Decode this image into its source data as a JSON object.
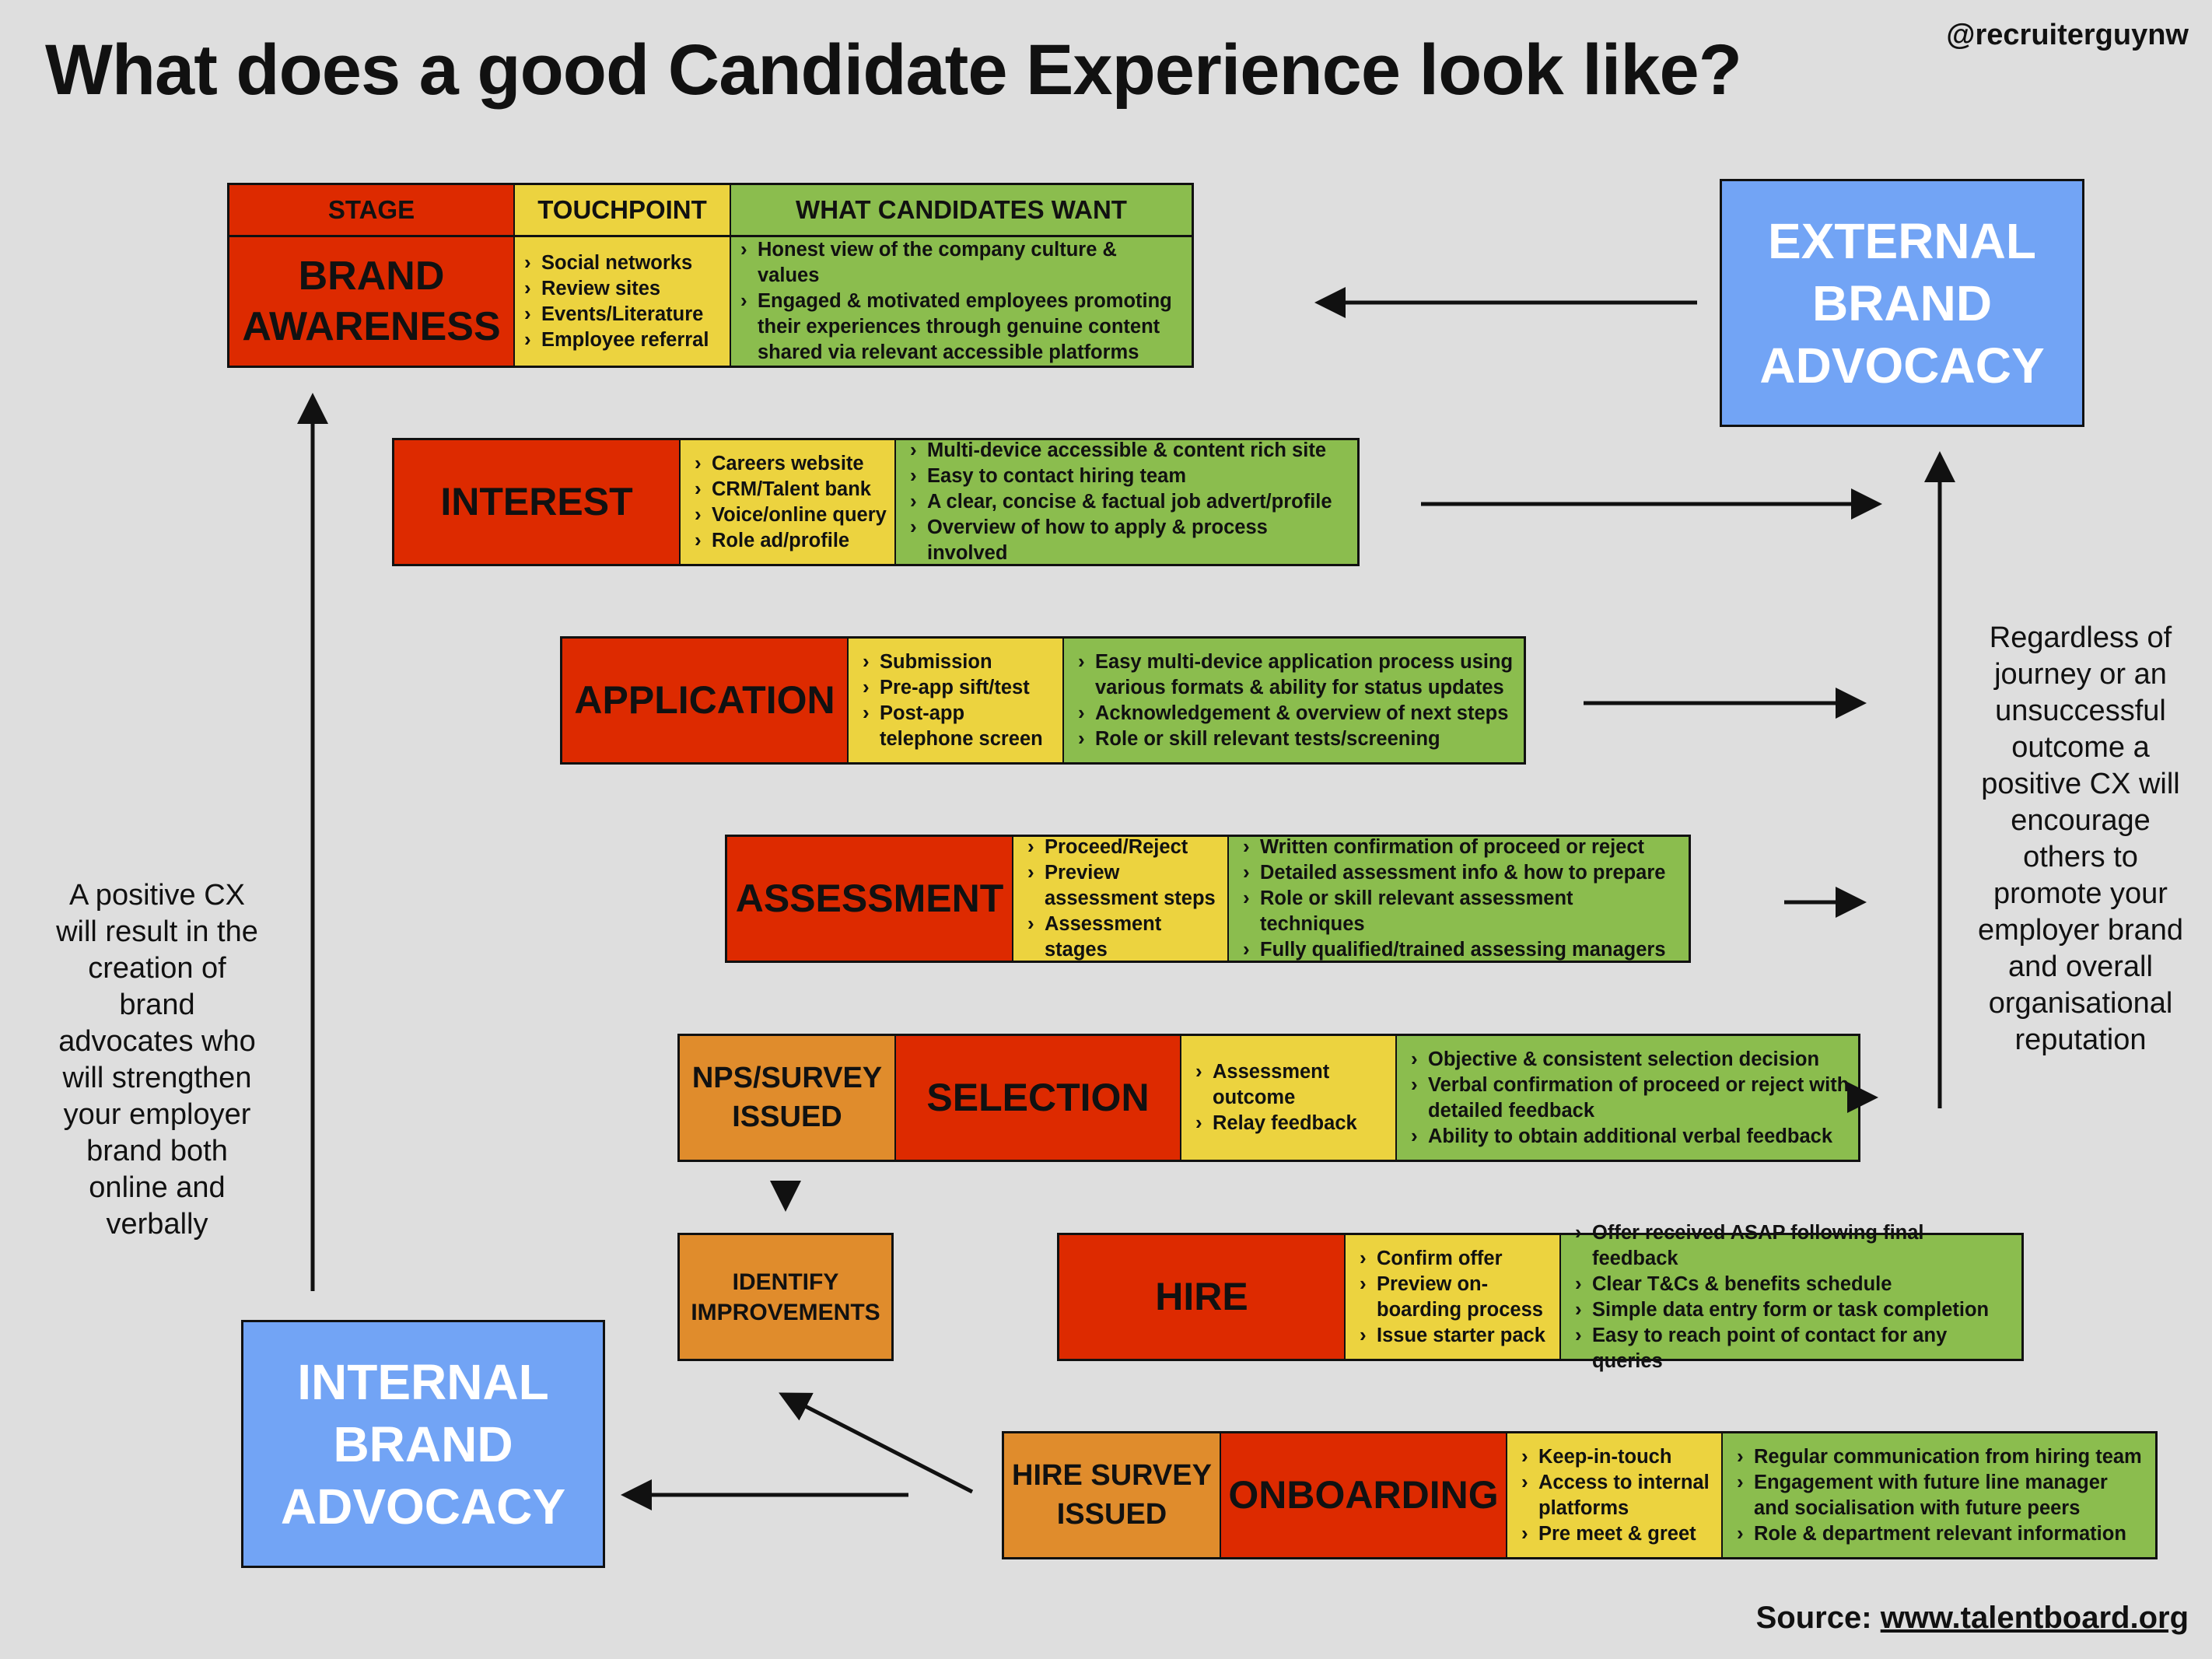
{
  "title": "What does a good Candidate Experience look like?",
  "handle": "@recruiterguynw",
  "source": {
    "label": "Source:",
    "link": "www.talentboard.org"
  },
  "colors": {
    "stage": "#dd2a00",
    "touchpoint": "#ecd33f",
    "want": "#8bbd4e",
    "survey": "#e08c2c",
    "advocacy": "#72a4f5",
    "background": "#dedede"
  },
  "headers": {
    "stage": "STAGE",
    "touchpoint": "TOUCHPOINT",
    "want": "WHAT CANDIDATES WANT"
  },
  "stages": [
    {
      "name": "BRAND AWARENESS",
      "touchpoints": [
        "Social networks",
        "Review sites",
        "Events/Literature",
        "Employee referral"
      ],
      "wants": [
        "Honest view of the company culture & values",
        "Engaged & motivated employees promoting their experiences through genuine content shared via relevant accessible platforms"
      ]
    },
    {
      "name": "INTEREST",
      "touchpoints": [
        "Careers website",
        "CRM/Talent bank",
        "Voice/online query",
        "Role ad/profile"
      ],
      "wants": [
        "Multi-device accessible & content rich site",
        "Easy to contact hiring team",
        "A clear, concise & factual job advert/profile",
        "Overview of how to apply & process involved"
      ]
    },
    {
      "name": "APPLICATION",
      "touchpoints": [
        "Submission",
        "Pre-app sift/test",
        "Post-app telephone screen"
      ],
      "wants": [
        "Easy multi-device application process using various formats & ability for status updates",
        "Acknowledgement & overview of next steps",
        "Role or skill relevant tests/screening"
      ]
    },
    {
      "name": "ASSESSMENT",
      "touchpoints": [
        "Proceed/Reject",
        "Preview assessment steps",
        "Assessment stages"
      ],
      "wants": [
        "Written confirmation of proceed or reject",
        "Detailed assessment info & how to prepare",
        "Role or skill relevant assessment techniques",
        "Fully qualified/trained assessing managers"
      ]
    },
    {
      "name": "SELECTION",
      "survey": "NPS/SURVEY ISSUED",
      "touchpoints": [
        "Assessment outcome",
        "Relay feedback"
      ],
      "wants": [
        "Objective & consistent selection decision",
        "Verbal confirmation of proceed or reject with detailed feedback",
        "Ability to obtain additional verbal feedback"
      ]
    },
    {
      "name": "HIRE",
      "touchpoints": [
        "Confirm offer",
        "Preview on-boarding process",
        "Issue starter pack"
      ],
      "wants": [
        "Offer received ASAP following final feedback",
        "Clear T&Cs & benefits schedule",
        "Simple data entry form or task completion",
        "Easy to reach point of contact for any queries"
      ]
    },
    {
      "name": "ONBOARDING",
      "survey": "HIRE SURVEY ISSUED",
      "touchpoints": [
        "Keep-in-touch",
        "Access to internal platforms",
        "Pre meet & greet"
      ],
      "wants": [
        "Regular communication from hiring team",
        "Engagement with future line manager and socialisation with future peers",
        "Role & department relevant information"
      ]
    }
  ],
  "identify_improvements": "IDENTIFY IMPROVEMENTS",
  "external_advocacy": "EXTERNAL BRAND ADVOCACY",
  "internal_advocacy": "INTERNAL BRAND ADVOCACY",
  "left_note": "A positive CX will result in the creation of brand advocates who will strengthen your employer brand both online and verbally",
  "right_note": "Regardless of journey or an unsuccessful outcome a positive CX will encourage others to promote your employer brand and overall organisational reputation"
}
